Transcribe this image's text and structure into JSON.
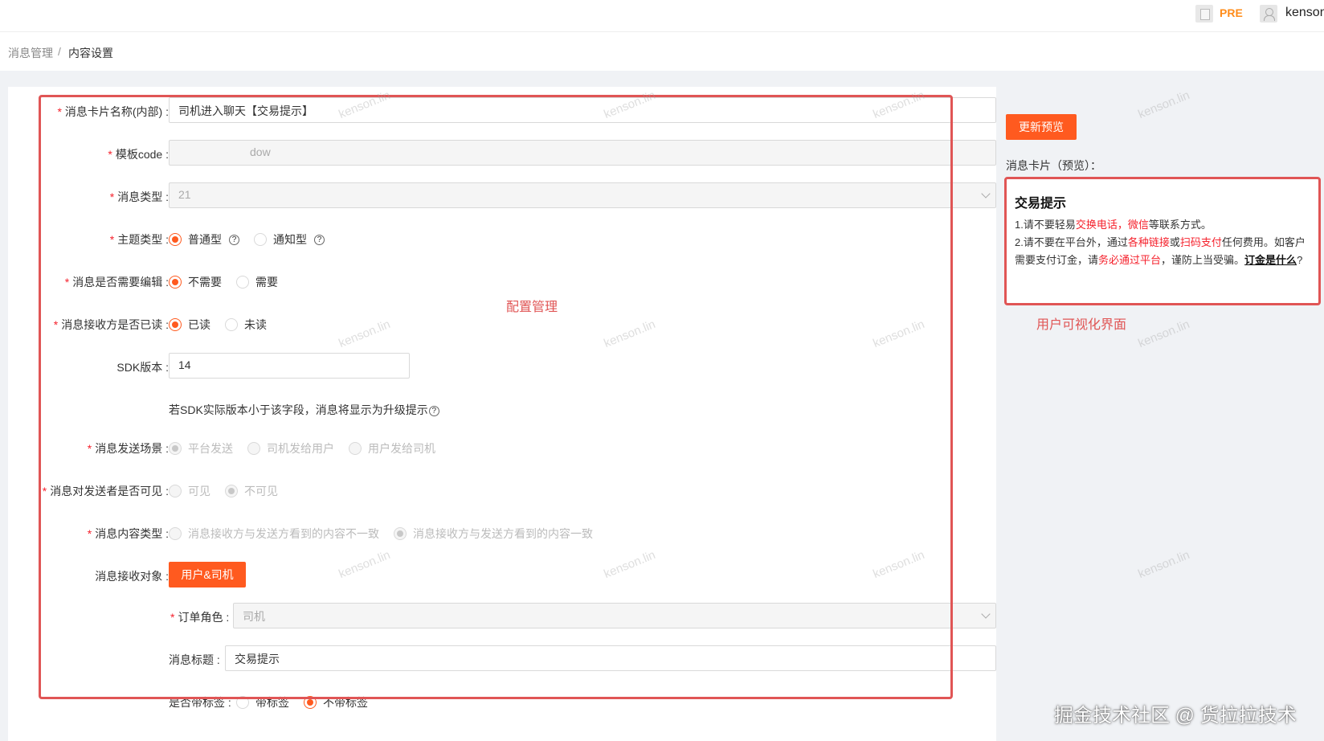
{
  "header": {
    "env_label": "PRE",
    "user_name": "kenson"
  },
  "breadcrumb": {
    "items": [
      "消息管理",
      "内容设置"
    ],
    "separator": "/"
  },
  "form": {
    "card_name": {
      "label": "消息卡片名称(内部) :",
      "value": "司机进入聊天【交易提示】"
    },
    "template_code": {
      "label": "模板code :",
      "value": "dow"
    },
    "message_type": {
      "label": "消息类型 :",
      "value": "21"
    },
    "theme_type": {
      "label": "主题类型 :",
      "options": [
        "普通型",
        "通知型"
      ]
    },
    "need_edit": {
      "label": "消息是否需要编辑 :",
      "options": [
        "不需要",
        "需要"
      ]
    },
    "receiver_read": {
      "label": "消息接收方是否已读 :",
      "options": [
        "已读",
        "未读"
      ]
    },
    "sdk_version": {
      "label": "SDK版本 :",
      "value": "14",
      "hint": "若SDK实际版本小于该字段，消息将显示为升级提示"
    },
    "send_scene": {
      "label": "消息发送场景 :",
      "options": [
        "平台发送",
        "司机发给用户",
        "用户发给司机"
      ]
    },
    "sender_visible": {
      "label": "消息对发送者是否可见 :",
      "options": [
        "可见",
        "不可见"
      ]
    },
    "content_type": {
      "label": "消息内容类型 :",
      "options": [
        "消息接收方与发送方看到的内容不一致",
        "消息接收方与发送方看到的内容一致"
      ]
    },
    "receiver_target": {
      "label": "消息接收对象 :",
      "button": "用户&司机"
    },
    "order_role": {
      "label": "订单角色 :",
      "value": "司机"
    },
    "message_title": {
      "label": "消息标题 :",
      "value": "交易提示"
    },
    "with_tag": {
      "label": "是否带标签 :",
      "options": [
        "带标签",
        "不带标签"
      ]
    }
  },
  "annotations": {
    "left": "配置管理",
    "right": "用户可视化界面"
  },
  "preview": {
    "button": "更新预览",
    "title": "消息卡片（预览）：",
    "card_title": "交易提示",
    "line1": {
      "p1": "1.请不要轻易",
      "r1": "交换电话，微信",
      "p2": "等联系方式。"
    },
    "line2": {
      "p1": "2.请不要在平台外，通过",
      "r1": "各种链接",
      "p2": "或",
      "r2": "扫码支付",
      "p3": "任何费用。如客户需要支付订金，请",
      "r3": "务必通过平台",
      "p4": "，谨防上当受骗。",
      "link": "订金是什么",
      "end": "?"
    }
  },
  "watermark": "kenson.lin",
  "credit": "掘金技术社区 @ 货拉拉技术",
  "colors": {
    "accent": "#ff5a1f",
    "annotation": "#e05555",
    "env": "#ff8c1a"
  }
}
